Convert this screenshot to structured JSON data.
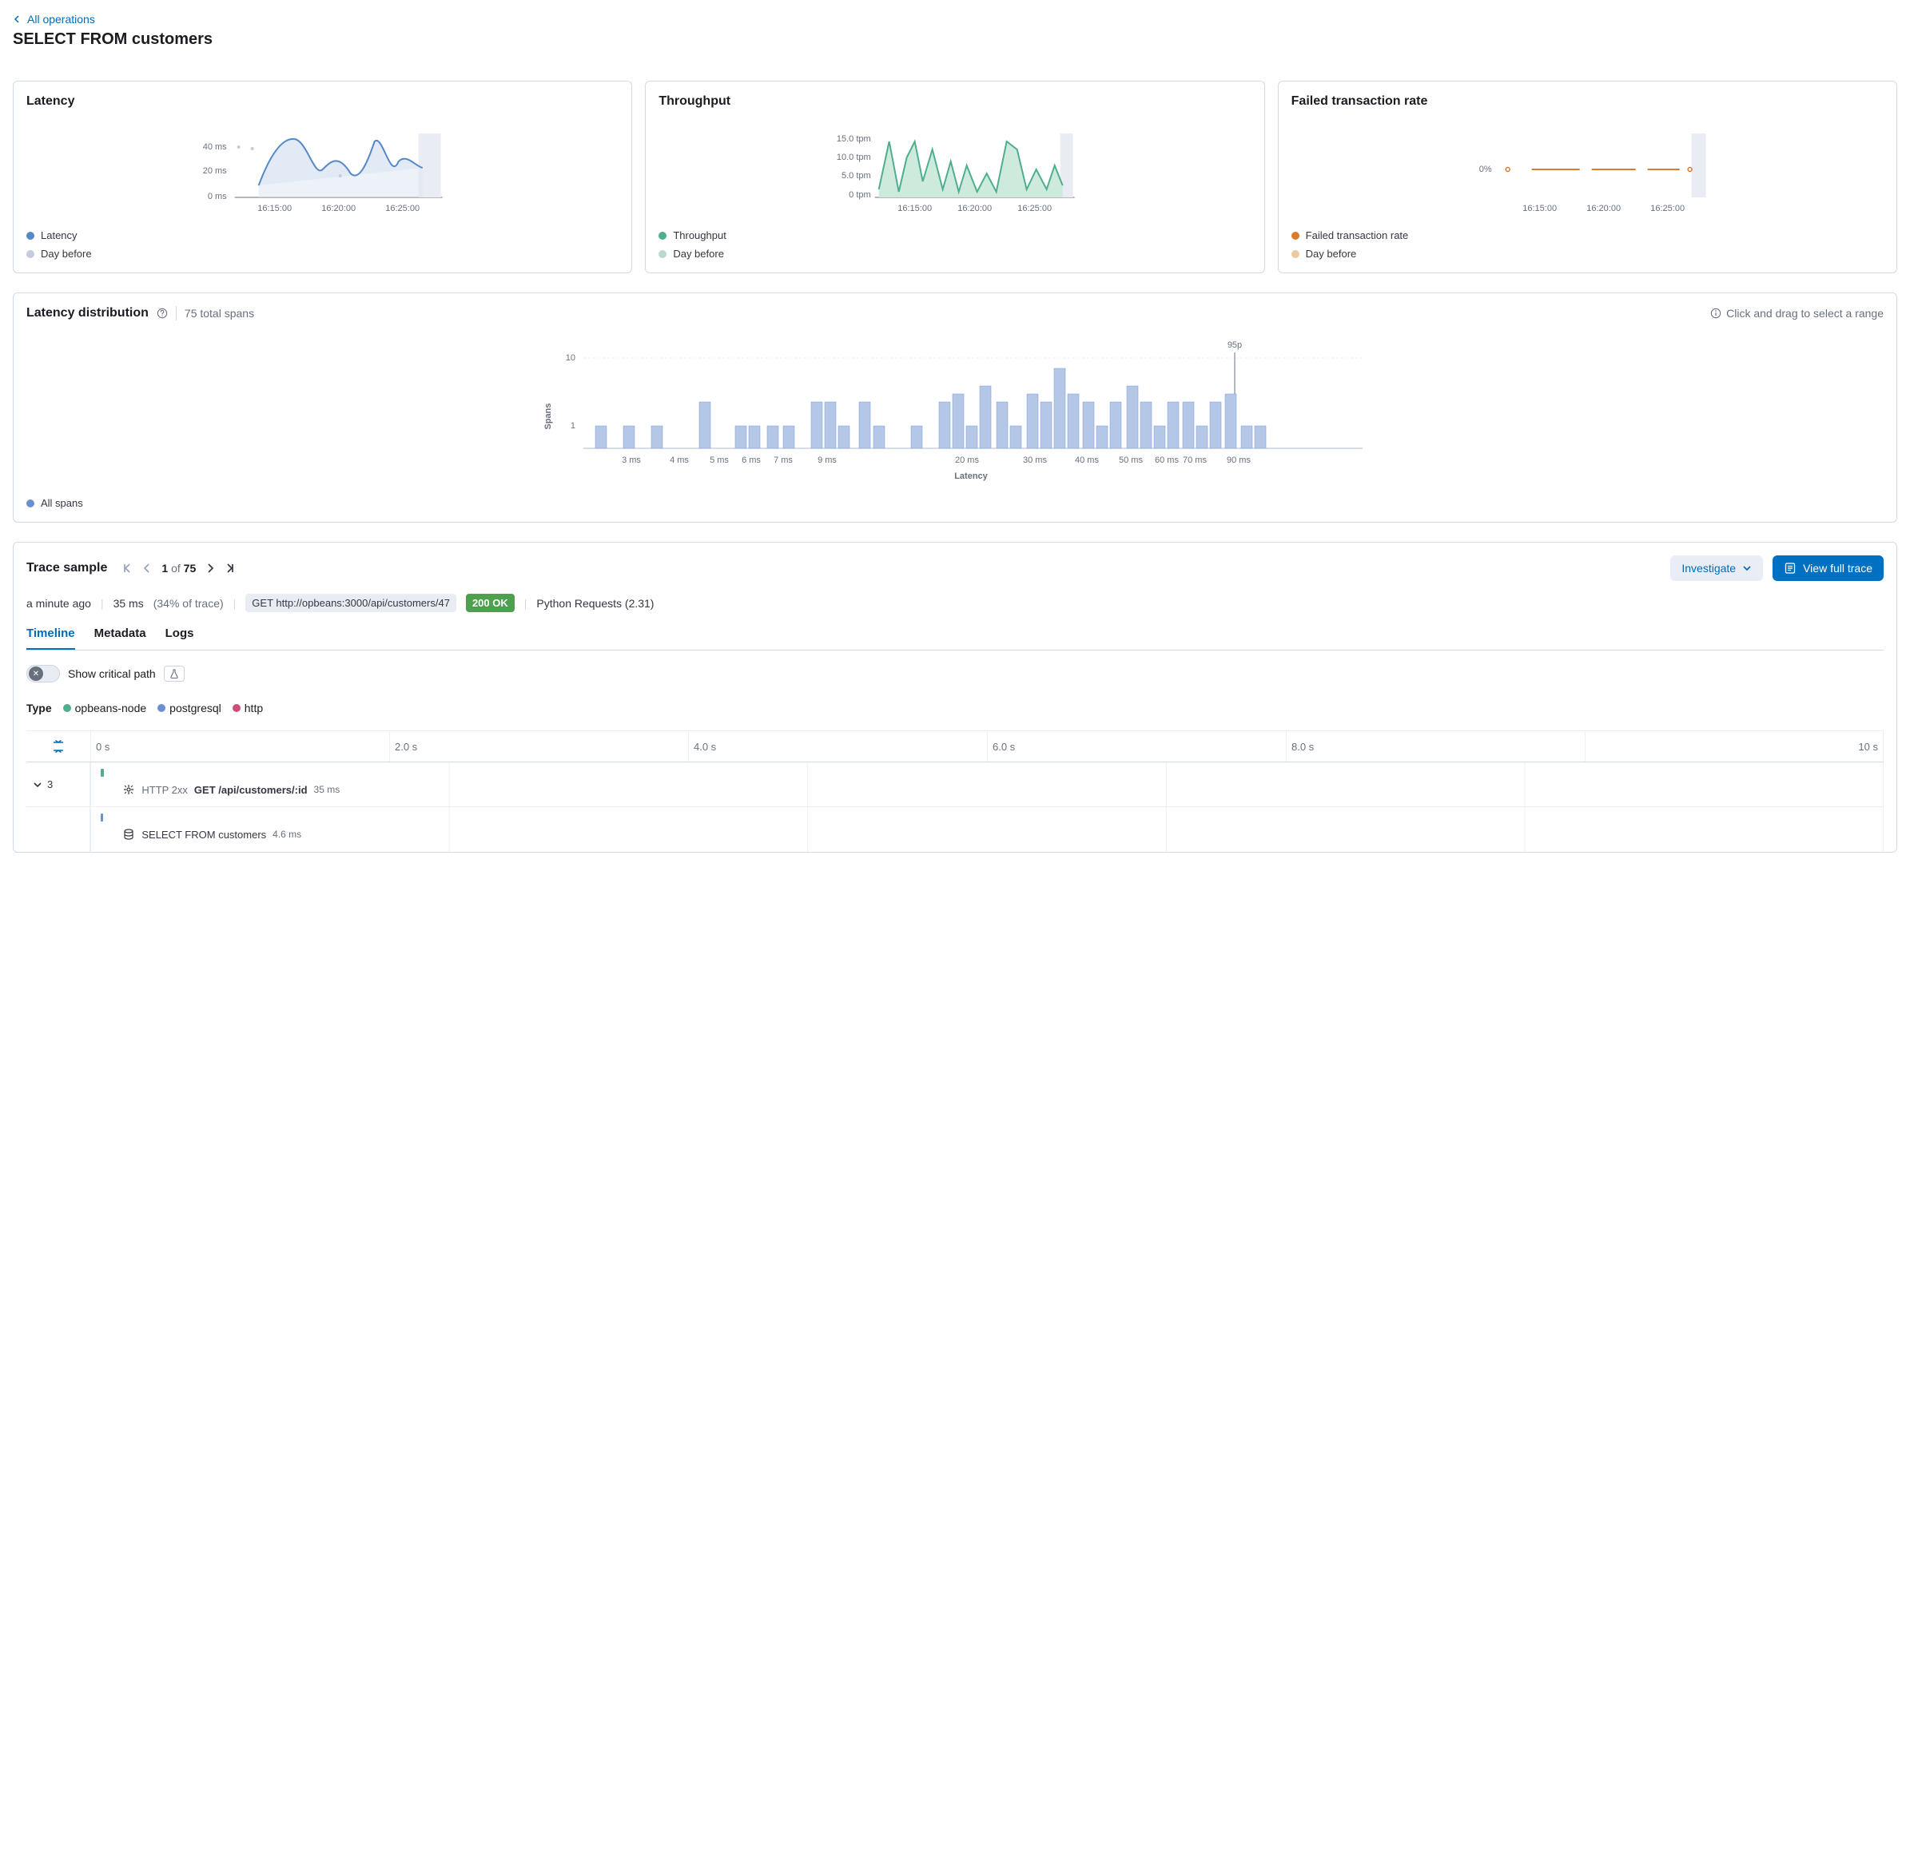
{
  "breadcrumb": {
    "back_label": "All operations"
  },
  "page_title": "SELECT FROM customers",
  "cards": {
    "latency": {
      "title": "Latency",
      "legend_primary": "Latency",
      "legend_secondary": "Day before",
      "primary_color": "#5488c7",
      "secondary_color": "#c3ccda"
    },
    "throughput": {
      "title": "Throughput",
      "legend_primary": "Throughput",
      "legend_secondary": "Day before",
      "primary_color": "#4fae8e",
      "secondary_color": "#b8d9cc"
    },
    "failed": {
      "title": "Failed transaction rate",
      "legend_primary": "Failed transaction rate",
      "legend_secondary": "Day before",
      "primary_color": "#d87b2f",
      "secondary_color": "#eccba4"
    }
  },
  "chart_data": [
    {
      "id": "latency_sparkline",
      "type": "line",
      "title": "Latency",
      "xlabel": "",
      "ylabel": "",
      "x_ticks": [
        "16:15:00",
        "16:20:00",
        "16:25:00"
      ],
      "y_ticks": [
        "0 ms",
        "20 ms",
        "40 ms"
      ],
      "ylim_ms": [
        0,
        50
      ],
      "series": [
        {
          "name": "Latency",
          "color": "#5488c7",
          "points_ms": [
            null,
            null,
            10,
            25,
            45,
            42,
            20,
            30,
            38,
            22,
            20,
            38,
            10,
            42,
            28,
            null
          ]
        },
        {
          "name": "Day before",
          "color": "#c3ccda",
          "style": "scatter",
          "points_ms": [
            40,
            38,
            null,
            null,
            null,
            null,
            null,
            null,
            20,
            null,
            null,
            null,
            null,
            null,
            null,
            null
          ]
        }
      ],
      "shaded_region_end": true
    },
    {
      "id": "throughput_sparkline",
      "type": "area",
      "title": "Throughput",
      "xlabel": "",
      "ylabel": "",
      "x_ticks": [
        "16:15:00",
        "16:20:00",
        "16:25:00"
      ],
      "y_ticks": [
        "0 tpm",
        "5.0 tpm",
        "10.0 tpm",
        "15.0 tpm"
      ],
      "ylim_tpm": [
        0,
        16
      ],
      "series": [
        {
          "name": "Throughput",
          "color": "#4fae8e",
          "points_tpm": [
            3,
            14,
            2,
            10,
            14,
            5,
            12,
            3,
            9,
            2,
            8,
            2,
            6,
            2,
            14,
            11,
            2,
            6
          ]
        }
      ],
      "shaded_region_end": true
    },
    {
      "id": "failed_sparkline",
      "type": "line",
      "title": "Failed transaction rate",
      "xlabel": "",
      "ylabel": "",
      "x_ticks": [
        "16:15:00",
        "16:20:00",
        "16:25:00"
      ],
      "y_ticks": [
        "0%"
      ],
      "ylim_pct": [
        0,
        1
      ],
      "series": [
        {
          "name": "Failed transaction rate",
          "color": "#d87b2f",
          "segments": [
            [
              0,
              0
            ],
            [
              0,
              0
            ],
            [
              0,
              0
            ],
            [
              0,
              0
            ]
          ],
          "note": "flat at 0% with small gaps"
        }
      ],
      "shaded_region_end": true
    },
    {
      "id": "latency_distribution",
      "type": "bar",
      "title": "Latency distribution",
      "xlabel": "Latency",
      "ylabel": "Spans",
      "yscale": "log",
      "y_ticks": [
        1,
        10
      ],
      "x_tick_labels_ms": [
        3,
        4,
        5,
        6,
        7,
        9,
        20,
        30,
        40,
        50,
        60,
        70,
        90
      ],
      "percentile_marker": {
        "label": "95p",
        "at_ms": 90
      },
      "categories_ms": [
        2.0,
        2.5,
        3.0,
        3.5,
        5.0,
        5.5,
        6.0,
        6.5,
        7.0,
        7.5,
        8.0,
        9.0,
        9.5,
        10.0,
        10.5,
        15.0,
        20.0,
        22.0,
        23.0,
        25.0,
        28.0,
        30.0,
        32.0,
        33.0,
        35.0,
        38.0,
        40.0,
        42.0,
        45.0,
        48.0,
        50.0,
        52.0,
        55.0,
        58.0,
        60.0,
        65.0,
        68.0,
        70.0,
        72.0,
        75.0,
        78.0,
        80.0,
        85.0,
        88.0,
        90.0,
        92.0,
        95.0
      ],
      "values": [
        1,
        1,
        1,
        1,
        2,
        1,
        1,
        1,
        2,
        2,
        1,
        2,
        1,
        1,
        1,
        1,
        2,
        3,
        1,
        2,
        1,
        3,
        1,
        2,
        5,
        3,
        2,
        1,
        2,
        1,
        3,
        2,
        1,
        2,
        1,
        2,
        2,
        1,
        2,
        1,
        2,
        1,
        1,
        2,
        3,
        1,
        1
      ],
      "legend": [
        "All spans"
      ],
      "color": "#b4c7e7"
    }
  ],
  "distribution": {
    "title": "Latency distribution",
    "count_label": "75 total spans",
    "hint": "Click and drag to select a range",
    "xlabel": "Latency",
    "ylabel": "Spans",
    "p95_label": "95p",
    "legend_all": "All spans"
  },
  "trace": {
    "title": "Trace sample",
    "pager_current": "1",
    "pager_of": "of",
    "pager_total": "75",
    "investigate": "Investigate",
    "view_full": "View full trace",
    "meta": {
      "age": "a minute ago",
      "duration": "35 ms",
      "pct_of_trace": "(34% of trace)",
      "request": "GET http://opbeans:3000/api/customers/47",
      "status": "200 OK",
      "client": "Python Requests (2.31)"
    },
    "tabs": {
      "timeline": "Timeline",
      "metadata": "Metadata",
      "logs": "Logs"
    },
    "critical_path_label": "Show critical path",
    "type_label": "Type",
    "types": [
      {
        "name": "opbeans-node",
        "color": "#4fae8e"
      },
      {
        "name": "postgresql",
        "color": "#6d8fd1"
      },
      {
        "name": "http",
        "color": "#ce4d7a"
      }
    ],
    "timeline_ticks": [
      "0 s",
      "2.0 s",
      "4.0 s",
      "6.0 s",
      "8.0 s",
      "10 s"
    ],
    "rows": [
      {
        "expand_count": "3",
        "bar_color": "#4fae8e",
        "status_pill": "HTTP 2xx",
        "op": "GET /api/customers/:id",
        "duration": "35 ms",
        "icon": "entry"
      },
      {
        "bar_color": "#6d8fd1",
        "op": "SELECT FROM customers",
        "duration": "4.6 ms",
        "icon": "db"
      }
    ]
  }
}
